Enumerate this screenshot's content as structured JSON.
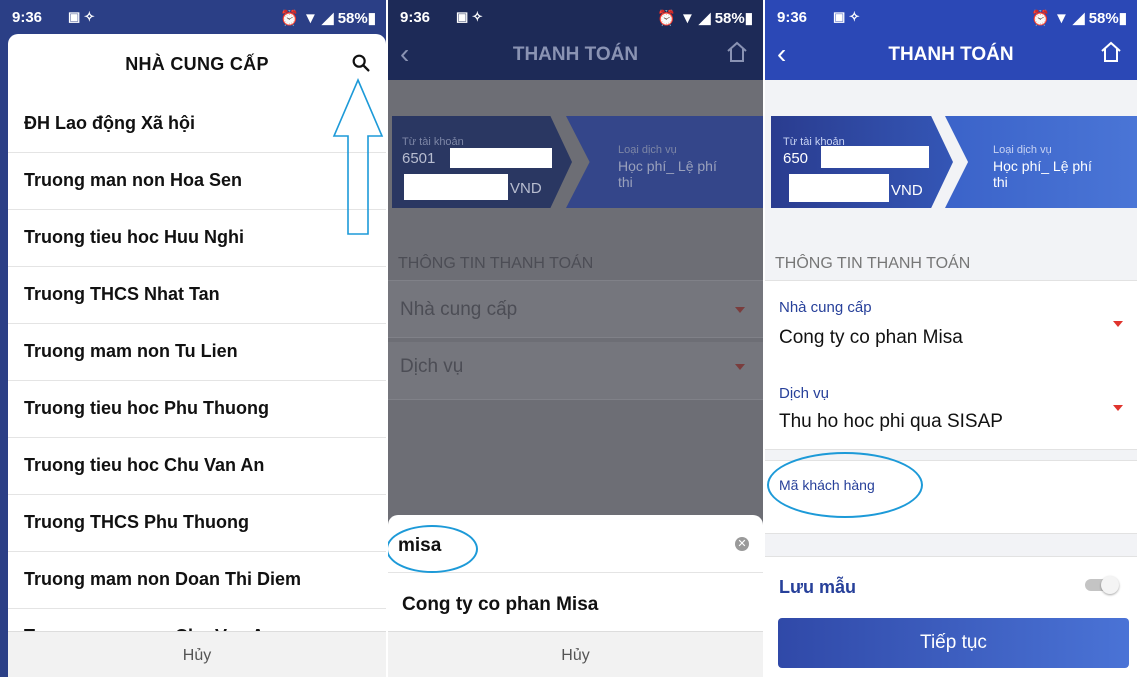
{
  "status": {
    "time": "9:36",
    "icons": "▣ ✧",
    "battery": "⏰ ▼ ◢ 58%▮"
  },
  "panel1": {
    "title": "NHÀ CUNG CẤP",
    "items": [
      "ĐH Lao động Xã hội",
      "Truong man non Hoa Sen",
      "Truong tieu hoc Huu Nghi",
      "Truong THCS Nhat Tan",
      "Truong mam non Tu Lien",
      "Truong tieu hoc Phu Thuong",
      "Truong tieu hoc Chu Van An",
      "Truong THCS Phu Thuong",
      "Truong mam non Doan Thi Diem",
      "Truong mam non Chu Van An"
    ],
    "cancel": "Hủy"
  },
  "panel2": {
    "title": "THANH TOÁN",
    "from_label": "Từ tài khoản",
    "account_prefix": "6501",
    "currency": "VND",
    "service_label": "Loại dịch vụ",
    "service_value": "Học phí_ Lệ phí thi",
    "section": "THÔNG TIN THANH TOÁN",
    "provider_placeholder": "Nhà cung cấp",
    "service_placeholder": "Dịch vụ",
    "search_value": "misa",
    "result": "Cong ty co phan Misa",
    "cancel": "Hủy"
  },
  "panel3": {
    "title": "THANH TOÁN",
    "from_label": "Từ tài khoản",
    "account_prefix": "650",
    "currency": "VND",
    "service_label": "Loại dịch vụ",
    "service_value": "Học phí_ Lệ phí thi",
    "section": "THÔNG TIN THANH TOÁN",
    "provider_label": "Nhà cung cấp",
    "provider_value": "Cong ty co phan Misa",
    "service_field_label": "Dịch vụ",
    "service_field_value": "Thu ho hoc phi qua SISAP",
    "customer_code_label": "Mã khách hàng",
    "save_template": "Lưu mẫu",
    "continue": "Tiếp tục"
  },
  "colors": {
    "navy": "#1d2a57",
    "blue": "#2b3f86",
    "accent": "#27409a",
    "annotation": "#1d9ad8",
    "arrow_red": "#e0342d"
  }
}
